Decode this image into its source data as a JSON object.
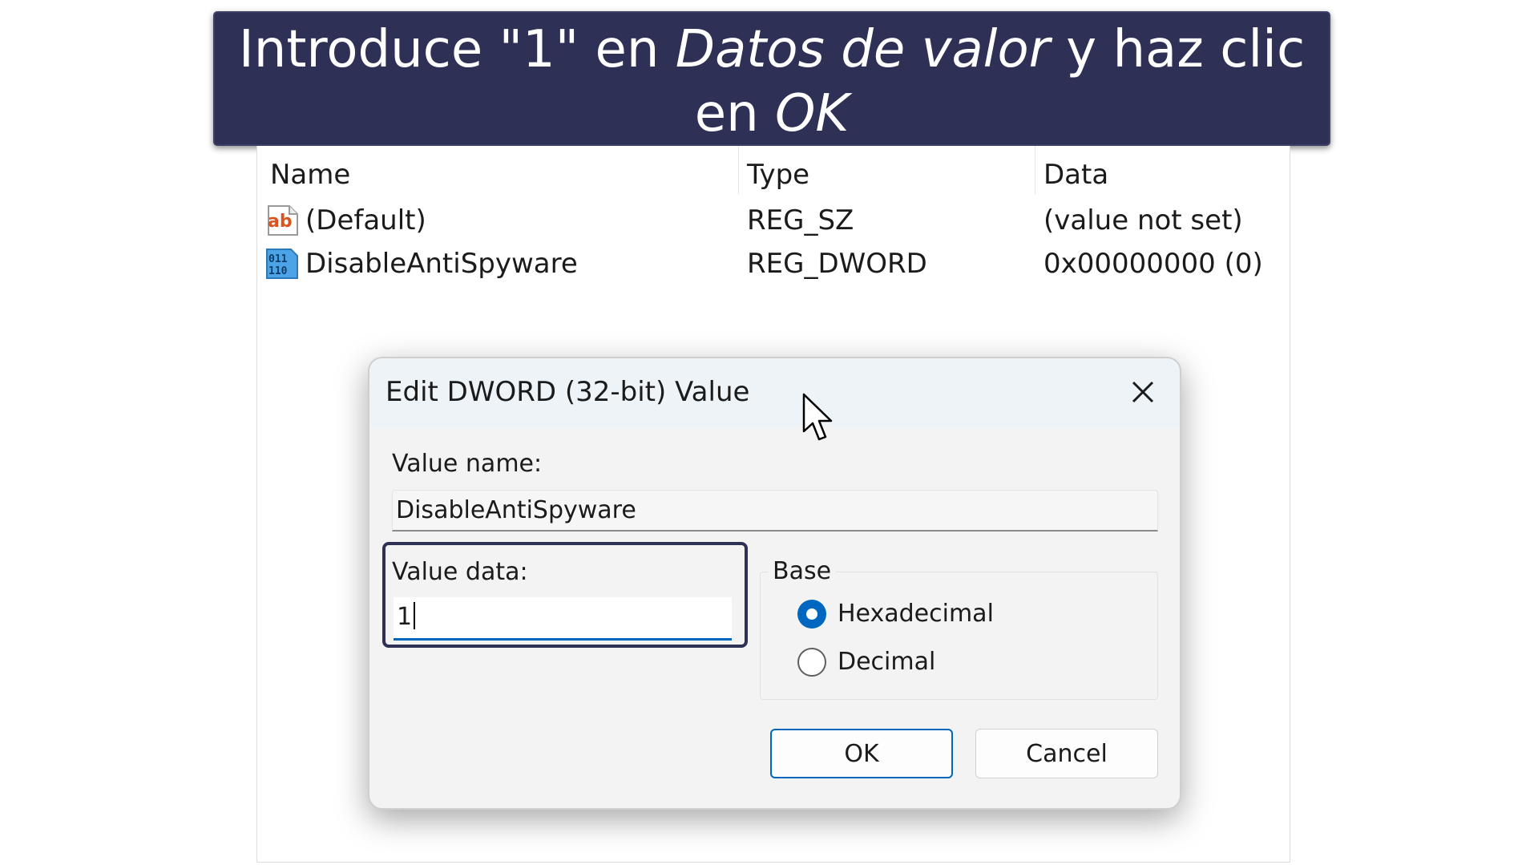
{
  "banner": {
    "part1": "Introduce \"1\" en ",
    "italic1": "Datos de valor",
    "part2": " y haz clic en ",
    "italic2": "OK"
  },
  "registry": {
    "columns": {
      "name": "Name",
      "type": "Type",
      "data": "Data"
    },
    "rows": [
      {
        "icon": "string-value-icon",
        "name": "(Default)",
        "type": "REG_SZ",
        "data": "(value not set)"
      },
      {
        "icon": "binary-value-icon",
        "name": "DisableAntiSpyware",
        "type": "REG_DWORD",
        "data": "0x00000000 (0)"
      }
    ]
  },
  "dialog": {
    "title": "Edit DWORD (32-bit) Value",
    "value_name_label": "Value name:",
    "value_name": "DisableAntiSpyware",
    "value_data_label": "Value data:",
    "value_data": "1",
    "base_label": "Base",
    "base_options": [
      {
        "label": "Hexadecimal",
        "selected": true
      },
      {
        "label": "Decimal",
        "selected": false
      }
    ],
    "ok_label": "OK",
    "cancel_label": "Cancel"
  },
  "colors": {
    "banner_bg": "#2f3056",
    "accent": "#0067c0",
    "highlight": "#2f3056"
  }
}
